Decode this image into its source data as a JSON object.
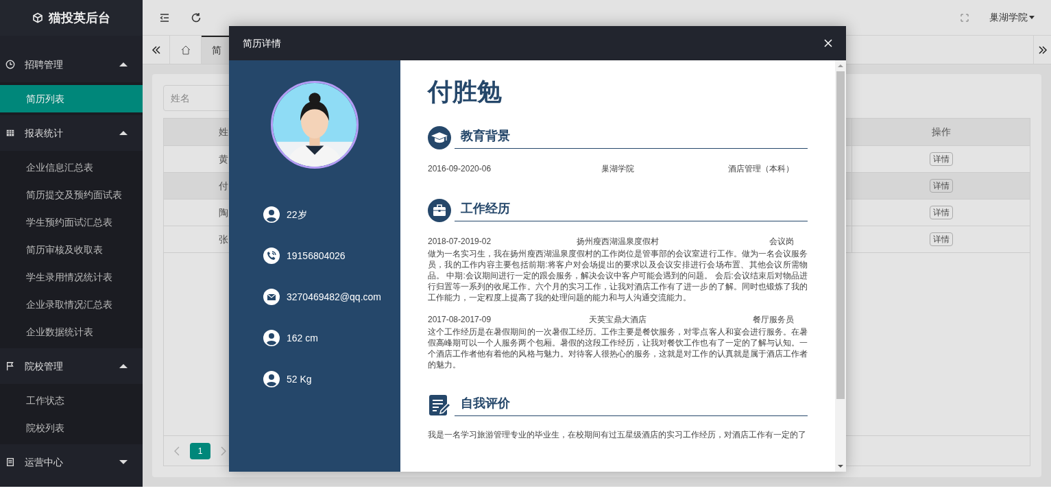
{
  "app": {
    "title": "猫投英后台"
  },
  "sidebar": {
    "groups": [
      {
        "label": "招聘管理",
        "kind": "clock",
        "expanded": true,
        "items": [
          {
            "label": "简历列表",
            "selected": true
          }
        ]
      },
      {
        "label": "报表统计",
        "kind": "grid",
        "expanded": true,
        "items": [
          {
            "label": "企业信息汇总表",
            "selected": false
          },
          {
            "label": "简历提交及预约面试表",
            "selected": false
          },
          {
            "label": "学生预约面试汇总表",
            "selected": false
          },
          {
            "label": "简历审核及收取表",
            "selected": false
          },
          {
            "label": "学生录用情况统计表",
            "selected": false
          },
          {
            "label": "企业录取情况汇总表",
            "selected": false
          },
          {
            "label": "企业数据统计表",
            "selected": false
          }
        ]
      },
      {
        "label": "院校管理",
        "kind": "flag",
        "expanded": true,
        "items": [
          {
            "label": "工作状态",
            "selected": false
          },
          {
            "label": "院校列表",
            "selected": false
          }
        ]
      },
      {
        "label": "运营中心",
        "kind": "doc",
        "expanded": false
      }
    ]
  },
  "topbar": {
    "user": "巢湖学院"
  },
  "tabs": [
    {
      "label": "简",
      "selected": true
    }
  ],
  "search": {
    "placeholder": "姓名"
  },
  "table": {
    "columns": [
      "姓",
      "操作"
    ],
    "rows": [
      {
        "name": "黄",
        "action": "详情",
        "selected": false
      },
      {
        "name": "付",
        "action": "详情",
        "selected": true
      },
      {
        "name": "陶",
        "action": "详情",
        "selected": false
      },
      {
        "name": "张",
        "action": "详情",
        "selected": false
      }
    ]
  },
  "pagination": {
    "pages": [
      {
        "label": "1",
        "selected": true
      }
    ]
  },
  "modal": {
    "title": "简历详情",
    "profile": [
      {
        "kind": "person",
        "text": "22岁"
      },
      {
        "kind": "phone",
        "text": "19156804026"
      },
      {
        "kind": "email",
        "text": "3270469482@qq.com"
      },
      {
        "kind": "person",
        "text": "162 cm"
      },
      {
        "kind": "person",
        "text": "52 Kg"
      }
    ],
    "name": "付胜勉",
    "sections": [
      {
        "kind": "education",
        "title": "教育背景",
        "entries": [
          {
            "date": "2016-09-2020-06",
            "org": "巢湖学院",
            "role": "酒店管理（本科）"
          }
        ]
      },
      {
        "kind": "work",
        "title": "工作经历",
        "entries": [
          {
            "date": "2018-07-2019-02",
            "org": "扬州瘦西湖温泉度假村",
            "role": "会议岗",
            "description": "做为一名实习生，我在扬州瘦西湖温泉度假村的工作岗位是管事部的会议室进行工作。做为一名会议服务员，我的工作内容主要包括前期:将客户对会场提出的要求以及会议安排进行会场布置、其他会议所需物品。 中期:会议期间进行一定的跟会服务，解决会议中客户可能会遇到的问题。 会后:会议结束后对物品进行归置等一系列的收尾工作。六个月的实习工作，让我对酒店工作有了进一步的了解。同时也锻炼了我的工作能力，一定程度上提高了我的处理问题的能力和与人沟通交流能力。"
          },
          {
            "date": "2017-08-2017-09",
            "org": "天英宝鼎大酒店",
            "role": "餐厅服务员",
            "description": "这个工作经历是在暑假期间的一次暑假工经历。工作主要是餐饮服务，对零点客人和宴会进行服务。在暑假高峰期可以一个人服务两个包厢。暑假的这段工作经历，让我对餐饮工作也有了一定的了解与认知。一个酒店工作者他有着他的风格与魅力。对待客人很热心的服务，这就是对工作的认真就是属于酒店工作者的魅力。"
          }
        ]
      },
      {
        "kind": "self",
        "title": "自我评价",
        "text": "我是一名学习旅游管理专业的毕业生，在校期间有过五星级酒店的实习工作经历，对酒店工作有一定的了"
      }
    ]
  }
}
